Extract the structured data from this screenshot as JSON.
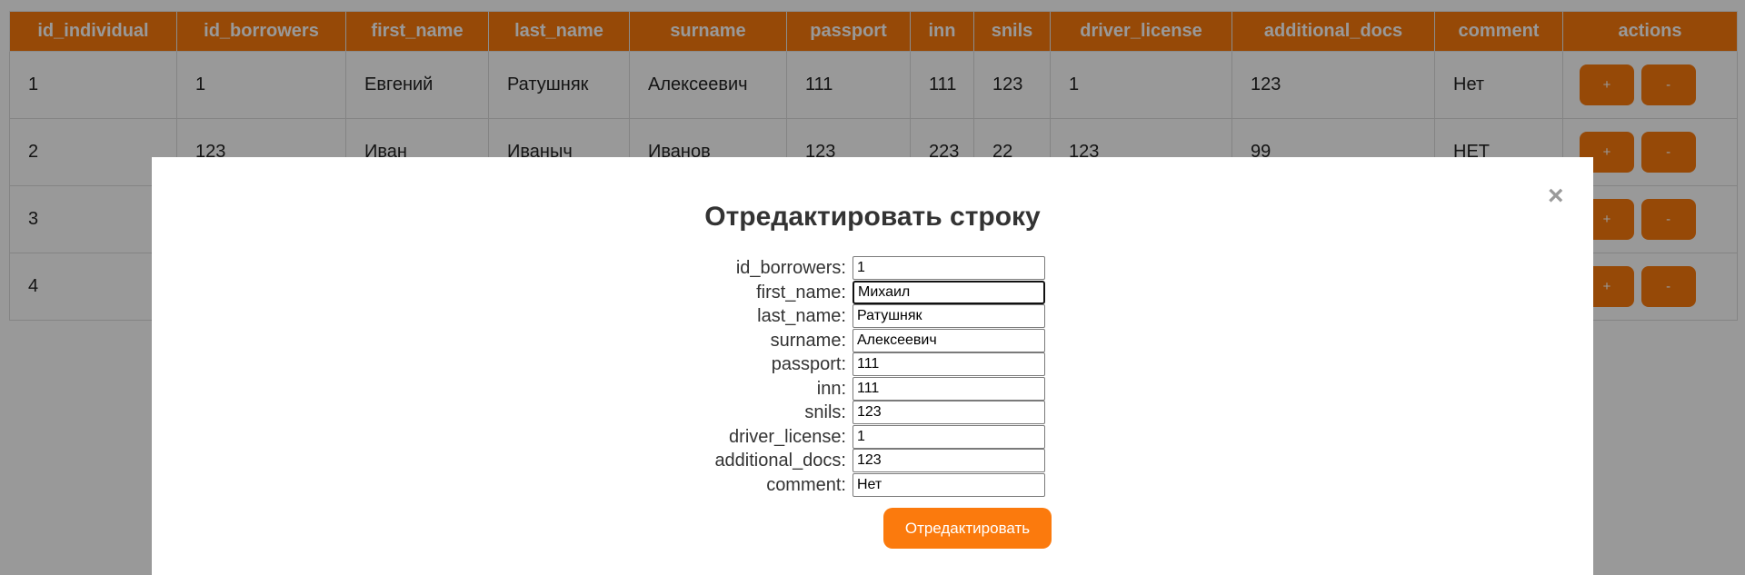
{
  "table": {
    "headers": [
      "id_individual",
      "id_borrowers",
      "first_name",
      "last_name",
      "surname",
      "passport",
      "inn",
      "snils",
      "driver_license",
      "additional_docs",
      "comment",
      "actions"
    ],
    "rows": [
      {
        "id_individual": "1",
        "id_borrowers": "1",
        "first_name": "Евгений",
        "last_name": "Ратушняк",
        "surname": "Алексеевич",
        "passport": "111",
        "inn": "111",
        "snils": "123",
        "driver_license": "1",
        "additional_docs": "123",
        "comment": "Нет"
      },
      {
        "id_individual": "2",
        "id_borrowers": "123",
        "first_name": "Иван",
        "last_name": "Иваныч",
        "surname": "Иванов",
        "passport": "123",
        "inn": "223",
        "snils": "22",
        "driver_license": "123",
        "additional_docs": "99",
        "comment": "НЕТ"
      },
      {
        "id_individual": "3",
        "id_borrowers": "",
        "first_name": "",
        "last_name": "",
        "surname": "",
        "passport": "",
        "inn": "",
        "snils": "",
        "driver_license": "",
        "additional_docs": "",
        "comment": ""
      },
      {
        "id_individual": "4",
        "id_borrowers": "",
        "first_name": "",
        "last_name": "",
        "surname": "",
        "passport": "",
        "inn": "",
        "snils": "",
        "driver_license": "",
        "additional_docs": "",
        "comment": ""
      }
    ],
    "add_label": "+",
    "remove_label": "-"
  },
  "modal": {
    "title": "Отредактировать строку",
    "close_label": "×",
    "submit_label": "Отредактировать",
    "fields": [
      {
        "label": "id_borrowers:",
        "value": "1"
      },
      {
        "label": "first_name:",
        "value": "Михаил"
      },
      {
        "label": "last_name:",
        "value": "Ратушняк"
      },
      {
        "label": "surname:",
        "value": "Алексеевич"
      },
      {
        "label": "passport:",
        "value": "111"
      },
      {
        "label": "inn:",
        "value": "111"
      },
      {
        "label": "snils:",
        "value": "123"
      },
      {
        "label": "driver_license:",
        "value": "1"
      },
      {
        "label": "additional_docs:",
        "value": "123"
      },
      {
        "label": "comment:",
        "value": "Нет"
      }
    ],
    "focused_field": "first_name:"
  },
  "colors": {
    "accent": "#fb7a0d",
    "overlay": "rgba(0,0,0,0.40)"
  }
}
